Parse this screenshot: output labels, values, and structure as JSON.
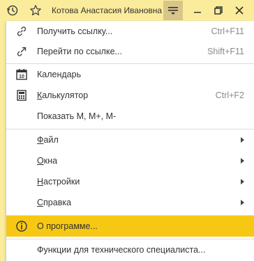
{
  "titlebar": {
    "user_name": "Котова Анастасия Ивановна",
    "background": "#fbec9b",
    "icons": [
      "history-icon",
      "star-icon",
      "main-menu-icon",
      "minimize-icon",
      "restore-icon",
      "close-icon"
    ]
  },
  "menu": {
    "get_link": {
      "label": "Получить ссылку...",
      "shortcut": "Ctrl+F11",
      "icon": "link-icon"
    },
    "follow_link": {
      "label": "Перейти по ссылке...",
      "shortcut": "Shift+F11",
      "icon": "link-arrow-icon"
    },
    "calendar": {
      "label": "Календарь",
      "icon": "calendar-icon",
      "icon_text": "10"
    },
    "calculator": {
      "label_underlined": "К",
      "label_rest": "алькулятор",
      "shortcut": "Ctrl+F2",
      "icon": "calculator-icon"
    },
    "memory": {
      "label": "Показать M, M+, M-"
    },
    "file": {
      "label_underlined": "Ф",
      "label_rest": "айл"
    },
    "windows": {
      "label_underlined": "О",
      "label_rest": "кна"
    },
    "settings": {
      "label_underlined": "Н",
      "label_rest": "астройки"
    },
    "help": {
      "label_underlined": "С",
      "label_rest": "правка"
    },
    "about": {
      "label": "О программе...",
      "icon": "info-icon",
      "highlight_color": "#f6c814"
    },
    "tech": {
      "label": "Функции для технического специалиста..."
    }
  }
}
